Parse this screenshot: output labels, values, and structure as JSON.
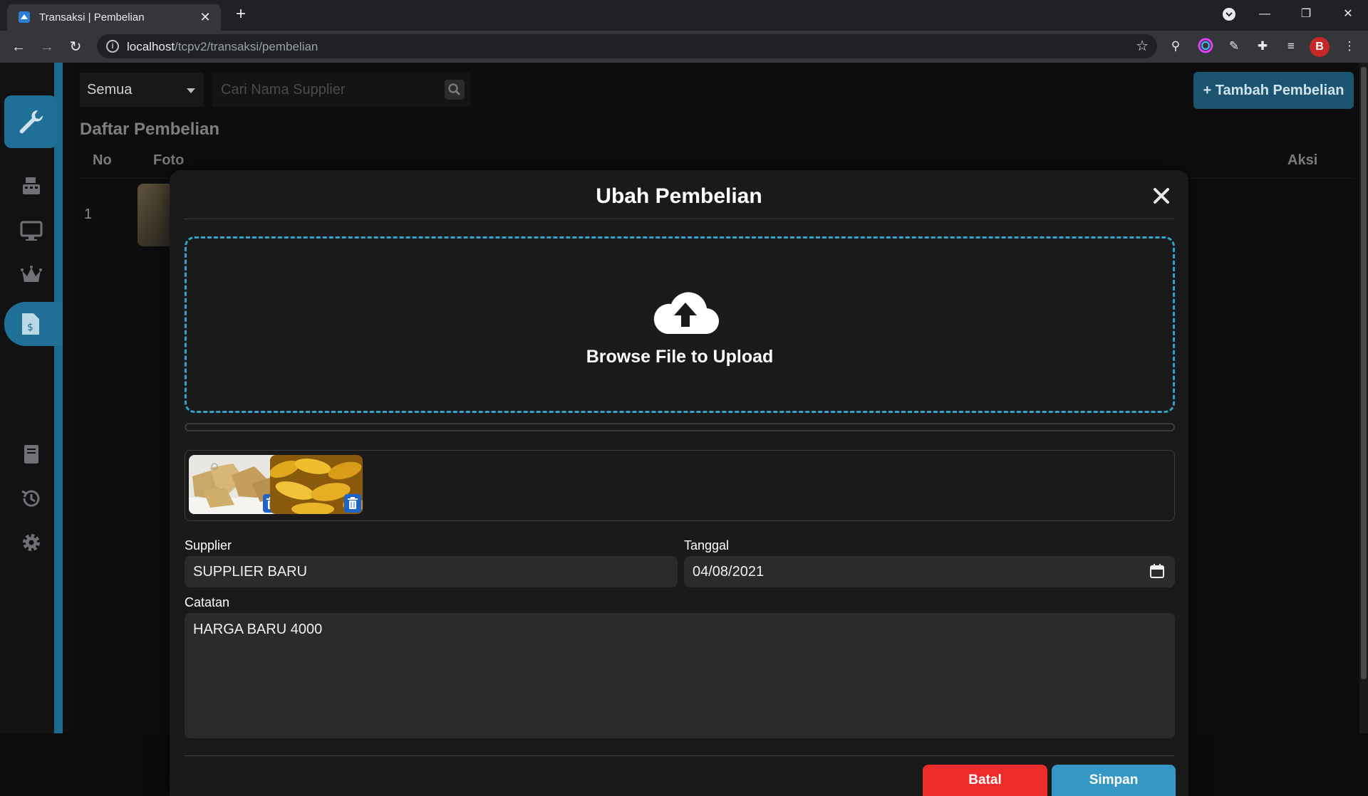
{
  "browser": {
    "tab_title": "Transaksi | Pembelian",
    "url_host": "localhost",
    "url_path": "/tcpv2/transaksi/pembelian"
  },
  "toolbar": {
    "filter_value": "Semua",
    "search_placeholder": "Cari Nama Supplier",
    "add_button": "+ Tambah Pembelian"
  },
  "list": {
    "title": "Daftar Pembelian",
    "columns": [
      "No",
      "Foto",
      "Aksi"
    ],
    "rows": [
      {
        "no": "1"
      }
    ]
  },
  "modal": {
    "title": "Ubah Pembelian",
    "dropzone_text": "Browse File to Upload",
    "supplier_label": "Supplier",
    "supplier_value": "SUPPLIER BARU",
    "date_label": "Tanggal",
    "date_value": "04/08/2021",
    "note_label": "Catatan",
    "note_value": "HARGA BARU 4000",
    "cancel_button": "Batal",
    "save_button": "Simpan"
  },
  "colors": {
    "accent": "#2fa3c9",
    "danger": "#ee2b2b",
    "primary": "#3597c6",
    "sidebar_active": "#1f6f96"
  }
}
